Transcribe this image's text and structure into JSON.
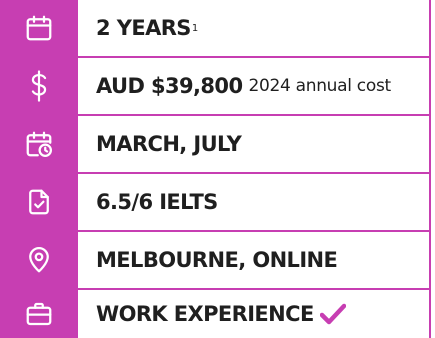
{
  "colors": {
    "accent": "#c73eb2",
    "text": "#1f1f1f",
    "icon": "#ffffff",
    "background": "#ffffff"
  },
  "rows": [
    {
      "icon": "calendar-icon",
      "label": "2 YEARS",
      "superscript": "1"
    },
    {
      "icon": "dollar-icon",
      "label": "AUD $39,800",
      "note": "2024 annual cost"
    },
    {
      "icon": "calendar-clock-icon",
      "label": "MARCH, JULY"
    },
    {
      "icon": "document-check-icon",
      "label": "6.5/6 IELTS"
    },
    {
      "icon": "location-pin-icon",
      "label": "MELBOURNE, ONLINE"
    },
    {
      "icon": "briefcase-icon",
      "label": "WORK EXPERIENCE",
      "check_icon": "checkmark-icon"
    }
  ]
}
